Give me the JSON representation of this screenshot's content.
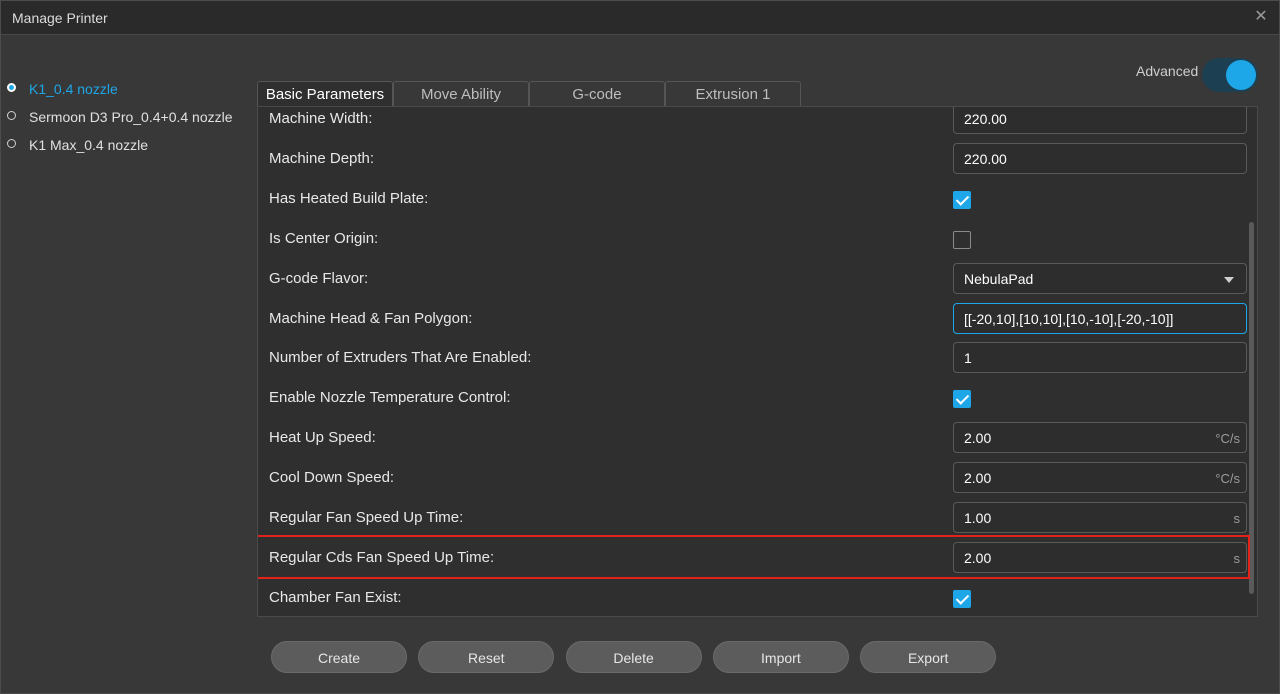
{
  "window": {
    "title": "Manage Printer",
    "close_icon": "close-icon"
  },
  "printers": [
    {
      "label": "K1_0.4 nozzle",
      "selected": true
    },
    {
      "label": "Sermoon D3 Pro_0.4+0.4 nozzle",
      "selected": false
    },
    {
      "label": "K1 Max_0.4 nozzle",
      "selected": false
    }
  ],
  "advanced": {
    "label": "Advanced",
    "enabled": true
  },
  "tabs": [
    {
      "label": "Basic Parameters",
      "active": true
    },
    {
      "label": "Move Ability",
      "active": false
    },
    {
      "label": "G-code",
      "active": false
    },
    {
      "label": "Extrusion 1",
      "active": false
    }
  ],
  "params": [
    {
      "label": "Machine Width:",
      "type": "text",
      "value": "220.00",
      "unit": ""
    },
    {
      "label": "Machine Depth:",
      "type": "text",
      "value": "220.00",
      "unit": ""
    },
    {
      "label": "Has Heated Build Plate:",
      "type": "checkbox",
      "checked": true
    },
    {
      "label": "Is Center Origin:",
      "type": "checkbox",
      "checked": false
    },
    {
      "label": "G-code Flavor:",
      "type": "select",
      "value": "NebulaPad"
    },
    {
      "label": "Machine Head & Fan Polygon:",
      "type": "text",
      "value": "[[-20,10],[10,10],[10,-10],[-20,-10]]",
      "unit": "",
      "focused": true
    },
    {
      "label": "Number of Extruders That Are Enabled:",
      "type": "text",
      "value": "1",
      "unit": ""
    },
    {
      "label": "Enable Nozzle Temperature Control:",
      "type": "checkbox",
      "checked": true
    },
    {
      "label": "Heat Up Speed:",
      "type": "text",
      "value": "2.00",
      "unit": "°C/s"
    },
    {
      "label": "Cool Down Speed:",
      "type": "text",
      "value": "2.00",
      "unit": "°C/s"
    },
    {
      "label": "Regular Fan Speed Up Time:",
      "type": "text",
      "value": "1.00",
      "unit": "s"
    },
    {
      "label": "Regular Cds Fan Speed Up Time:",
      "type": "text",
      "value": "2.00",
      "unit": "s",
      "highlighted": true
    },
    {
      "label": "Chamber Fan Exist:",
      "type": "checkbox",
      "checked": true
    }
  ],
  "buttons": [
    {
      "label": "Create"
    },
    {
      "label": "Reset"
    },
    {
      "label": "Delete"
    },
    {
      "label": "Import"
    },
    {
      "label": "Export"
    }
  ],
  "colors": {
    "accent": "#1ea7e8",
    "highlight": "#e2231a"
  }
}
